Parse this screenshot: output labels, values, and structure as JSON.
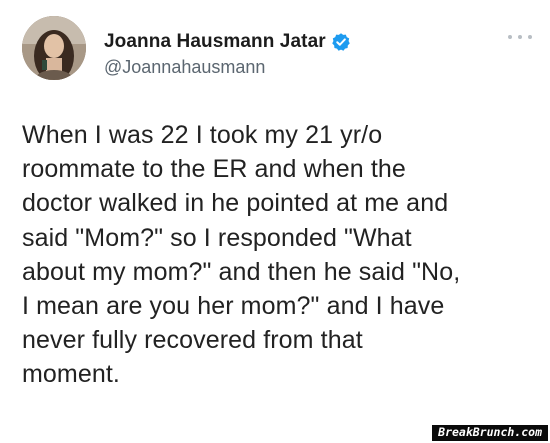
{
  "tweet": {
    "author": {
      "display_name": "Joanna Hausmann Jatar",
      "handle": "@Joannahausmann",
      "verified": true,
      "avatar": "profile-photo"
    },
    "text": "When I was 22 I took my 21 yr/o\nroommate to the ER and when the\ndoctor walked in he pointed at me and\nsaid \"Mom?\" so I responded \"What\nabout my mom?\" and then he said \"No,\nI mean are you her mom?\" and I have\nnever fully recovered from that\nmoment."
  },
  "icons": {
    "verified": "verified-badge-icon",
    "more": "more-options-icon"
  },
  "watermark": {
    "text": "BreakBrunch.com"
  },
  "colors": {
    "verified_blue": "#1d9bf0",
    "handle_gray": "#5b6670",
    "text": "#222222",
    "watermark_bg": "#0a0a0a"
  }
}
